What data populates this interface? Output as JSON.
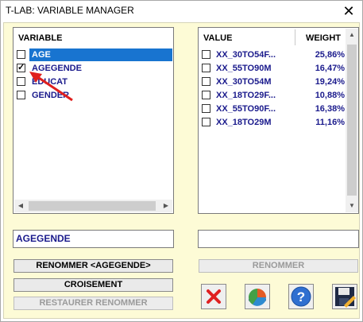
{
  "window": {
    "title": "T-LAB: VARIABLE MANAGER",
    "close_glyph": "✕"
  },
  "variables": {
    "header": "VARIABLE",
    "items": [
      {
        "label": "AGE",
        "checked": false,
        "selected": true
      },
      {
        "label": "AGEGENDE",
        "checked": true,
        "selected": false
      },
      {
        "label": "EDUCAT",
        "checked": false,
        "selected": false
      },
      {
        "label": "GENDER",
        "checked": false,
        "selected": false
      }
    ]
  },
  "values": {
    "header_value": "VALUE",
    "header_weight": "WEIGHT",
    "rows": [
      {
        "value": "XX_30TO54F...",
        "weight": "25,86%"
      },
      {
        "value": "XX_55TO90M",
        "weight": "16,47%"
      },
      {
        "value": "XX_30TO54M",
        "weight": "19,24%"
      },
      {
        "value": "XX_18TO29F...",
        "weight": "10,88%"
      },
      {
        "value": "XX_55TO90F...",
        "weight": "16,38%"
      },
      {
        "value": "XX_18TO29M",
        "weight": "11,16%"
      }
    ]
  },
  "fields": {
    "left_value": "AGEGENDE",
    "right_value": ""
  },
  "buttons": {
    "rename_left": "RENOMMER <AGEGENDE>",
    "crossing": "CROISEMENT",
    "restore": "RESTAURER RENOMMER",
    "rename_right": "RENOMMER"
  },
  "icons": [
    "delete-icon",
    "pie-chart-icon",
    "help-icon",
    "save-icon"
  ],
  "colors": {
    "client_bg": "#fdfbd6",
    "text_blue": "#1a1a8c",
    "selection": "#1874d0",
    "annotation_arrow": "#e0201e"
  }
}
